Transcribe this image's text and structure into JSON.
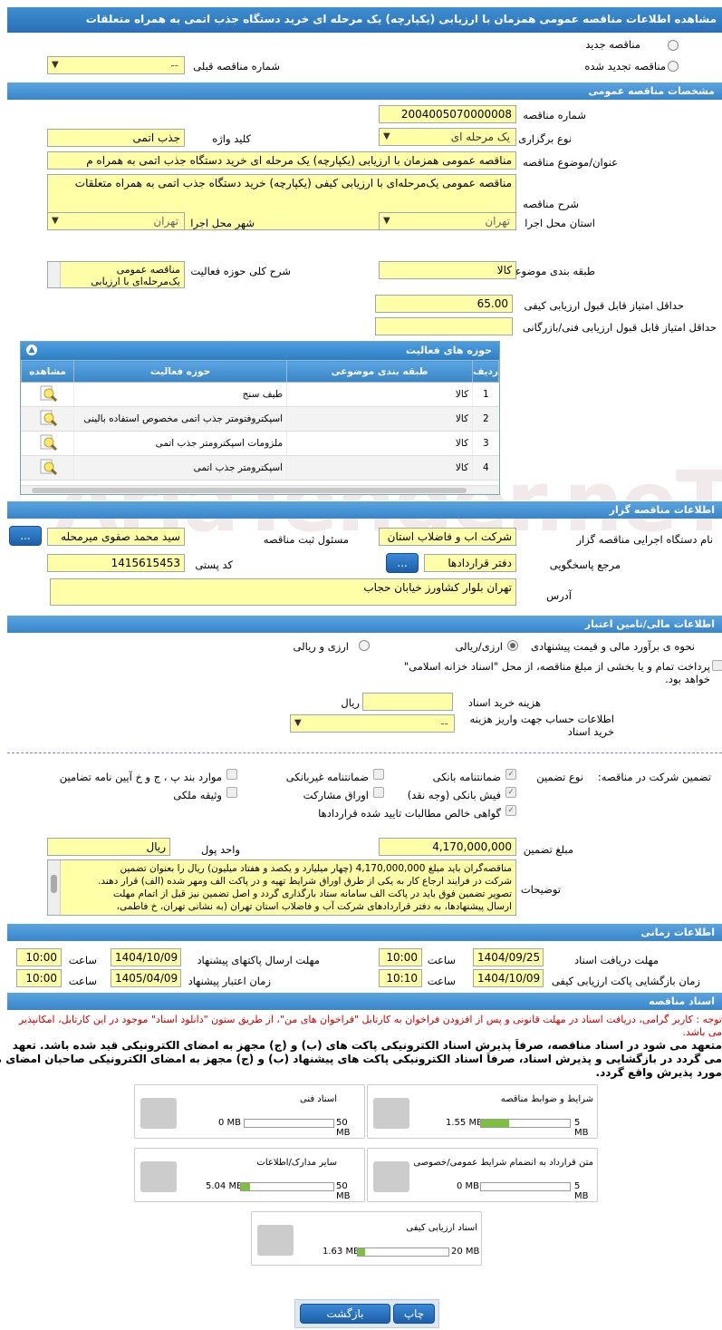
{
  "title": "مشاهده اطلاعات مناقصه عمومی همزمان با ارزیابی (یکپارچه) یک مرحله ای خرید دستگاه جذب اتمی به همراه متعلقات",
  "top": {
    "radio_new": "مناقصه جدید",
    "radio_renew": "مناقصه تجدید شده",
    "prev_number_label": "شماره مناقصه قبلی",
    "prev_number_value": "--"
  },
  "general": {
    "header": "مشخصات مناقصه عمومی",
    "number_label": "شماره مناقصه",
    "number_value": "2004005070000008",
    "type_label": "نوع برگزاری",
    "type_value": "یک مرحله ای",
    "keyword_label": "کلید واژه",
    "keyword_value": "جذب اتمی",
    "subject_label": "عنوان/موضوع مناقصه",
    "subject_value": "مناقصه عمومی همزمان با ارزیابی (یکپارچه) یک مرحله ای خرید دستگاه جذب اتمی به همراه م",
    "desc_label": "شرح مناقصه",
    "desc_value": "مناقصه عمومی یک‌مرحله‌ای با ارزیابی کیفی (یکپارچه) خرید دستگاه جذب اتمی به همراه متعلقات",
    "province_label": "استان محل اجرا",
    "province_value": "تهران",
    "city_label": "شهر محل اجرا",
    "city_value": "تهران",
    "category_label": "طبقه بندی موضوعی",
    "category_value": "کالا",
    "scope_label": "شرح کلی حوزه فعالیت",
    "scope_value_1": "مناقصه عمومی",
    "scope_value_2": "یک‌مرحله‌ای با ارزیابی",
    "min_quality_label": "حداقل امتیاز قابل قبول ارزیابی کیفی",
    "min_quality_value": "65.00",
    "min_tech_label": "حداقل امتیاز قابل قبول ارزیابی فنی/بازرگانی",
    "min_tech_value": ""
  },
  "activities": {
    "header": "حوزه های فعالیت",
    "columns": [
      "ردیف",
      "طبقه بندی موضوعی",
      "حوزه فعالیت",
      "مشاهده"
    ],
    "rows": [
      {
        "n": "1",
        "cat": "کالا",
        "field": "طیف سنج"
      },
      {
        "n": "2",
        "cat": "کالا",
        "field": "اسپکتروفتومتر جذب اتمی مخصوص استفاده بالینی"
      },
      {
        "n": "3",
        "cat": "کالا",
        "field": "ملزومات اسپکترومتر جذب اتمی"
      },
      {
        "n": "4",
        "cat": "کالا",
        "field": "اسپکترومتر جذب اتمی"
      }
    ]
  },
  "organizer": {
    "header": "اطلاعات مناقصه گزار",
    "org_label": "نام دستگاه اجرایی مناقصه گزار",
    "org_value": "شرکت اب و فاضلاب استان",
    "resp_label": "مسئول ثبت مناقصه",
    "resp_value": "سید محمد صفوی میرمحله",
    "ref_label": "مرجع پاسخگویی",
    "ref_value": "دفتر قراردادها",
    "postal_label": "کد پستی",
    "postal_value": "1415615453",
    "address_label": "آدرس",
    "address_value": "تهران بلوار کشاورز خیابان حجاب",
    "dots": "..."
  },
  "finance": {
    "header": "اطلاعات مالی/تامین اعتبار",
    "estimate_label": "نحوه ی برآورد مالی و قیمت پیشنهادی",
    "opt_rial_currency": "ارزی/ریالی",
    "opt_currency_rial": "ارزی و ریالی",
    "treasury_text": "پرداخت تمام و یا بخشی از مبلغ مناقصه، از محل \"اسناد خزانه اسلامی\" خواهد بود.",
    "doc_fee_label": "هزینه خرید اسناد",
    "doc_fee_value": "",
    "doc_fee_unit": "ریال",
    "account_label": "اطلاعات حساب جهت واریز هزینه خرید اسناد",
    "account_value": "--"
  },
  "guarantee": {
    "participation_label": "تضمین شرکت در مناقصه:",
    "type_label": "نوع تضمین",
    "items": {
      "bank_guarantee": "ضمانتنامه بانکی",
      "non_bank": "ضمانتنامه غیربانکی",
      "clauses": "موارد بند پ ، ج و خ آیین نامه تضامین",
      "bank_receipt": "فیش بانکی (وجه نقد)",
      "bonds": "اوراق مشارکت",
      "property": "وثیقه ملکی",
      "claims": "گواهی خالص مطالبات تایید شده قراردادها"
    },
    "amount_label": "مبلغ تضمین",
    "amount_value": "4,170,000,000",
    "currency_label": "واحد پول",
    "currency_value": "ریال",
    "notes_label": "توضیحات",
    "notes_lines": [
      "مناقصه‌گران باید مبلغ   4,170,000,000  (چهار میلیارد  و یکصد و هفتاد میلیون) ریال  را بعنوان تضمین",
      "شرکت در فرایند ارجاع کار به یکی از طرق اوراق شرایط تهیه و در پاکت الف ومهر شده (الف) قرار دهند.",
      "تصویر تضمین فوق باید در پاکت الف سامانه ستاد بارگذاری گردد و اصل تضمین نیز قبل از اتمام مهلت",
      "ارسال پیشنهادها، به دفتر قراردادهای شرکت آب و فاضلاب استان تهران (به نشانی تهران، خ فاطمی،"
    ]
  },
  "timing": {
    "header": "اطلاعات زمانی",
    "doc_deadline_label": "مهلت دریافت اسناد",
    "doc_deadline_date": "1404/09/25",
    "doc_deadline_time": "10:00",
    "send_deadline_label": "مهلت ارسال پاکتهای پیشنهاد",
    "send_deadline_date": "1404/10/09",
    "send_deadline_time": "10:00",
    "open_label": "زمان بازگشایی پاکت ارزیابی کیفی",
    "open_date": "1404/10/09",
    "open_time": "10:10",
    "validity_label": "زمان اعتبار پیشنهاد",
    "validity_date": "1405/04/09",
    "validity_time": "10:00",
    "hour_label": "ساعت"
  },
  "documents": {
    "header": "اسناد مناقصه",
    "notice": "توجه : کاربر گرامی، دریافت اسناد در مهلت قانونی و پس از افزودن فراخوان به کارتابل \"فراخوان های من\"، از طریق ستون \"دانلود اسناد\" موجود در این کارتابل، امکانپذیر می باشد.",
    "commit_1": "متعهد می شود در اسناد مناقصه، صرفاً پذیرش اسناد الکترونیکی پاکت های (ب) و (ج) مجهز به امضای الکترونیکی قید شده باشد. تعهد",
    "commit_2": "می گردد در بازگشایی و پذیرش اسناد، صرفاً اسناد الکترونیکی پاکت های پیشنهاد (ب) و (ج) مجهز به امضای الکترونیکی صاحبان امضای مجاز",
    "commit_3": "مورد پذیرش واقع گردد.",
    "files": [
      {
        "name": "شرایط و ضوابط مناقصه",
        "used": "1.55 MB",
        "max": "5 MB",
        "pct": 31
      },
      {
        "name": "اسناد فنی",
        "used": "0 MB",
        "max": "50 MB",
        "pct": 0
      },
      {
        "name": "متن قرارداد به انضمام شرایط عمومی/خصوصی",
        "used": "0 MB",
        "max": "5 MB",
        "pct": 0
      },
      {
        "name": "سایر مدارک/اطلاعات",
        "used": "5.04 MB",
        "max": "50 MB",
        "pct": 10
      },
      {
        "name": "اسناد ارزیابی کیفی",
        "used": "1.63 MB",
        "max": "20 MB",
        "pct": 8
      }
    ]
  },
  "actions": {
    "print": "چاپ",
    "back": "بازگشت"
  },
  "watermark": "AriaTender.neT"
}
